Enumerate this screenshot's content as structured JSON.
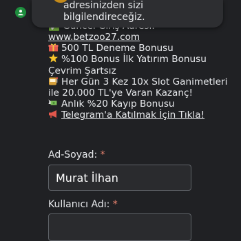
{
  "toast": {
    "line1": "adresinizden sizi",
    "line2": "bilgilendireceğiz."
  },
  "message": {
    "cut_line": "✅ Güncel Giriş Adresi:",
    "site_link": "www.betzoo27.com",
    "bonus1": "500 TL Deneme Bonusu",
    "bonus2": "%100 Bonus İlk Yatırım Bonusu",
    "bonus2b": "Çevrim Şartsız",
    "bonus3": "Her Gün 3 Kez 10x Slot Ganimetleri ile 20.000 TL'ye Varan Kazanç!",
    "bonus4": "Anlık %20 Kayıp Bonusu",
    "telegram_link": "Telegram'a Katılmak İçin Tıkla!"
  },
  "form": {
    "name_label": "Ad-Soyad:",
    "name_value": "Murat İlhan",
    "username_label": "Kullanıcı Adı:",
    "username_value": "",
    "required_mark": "*"
  },
  "icons": {
    "avatar": "person-icon",
    "gift": "gift-icon",
    "star": "star-icon",
    "slot": "slot-machine-icon",
    "money": "money-wings-icon",
    "megaphone": "megaphone-icon"
  },
  "colors": {
    "background": "#202124",
    "avatar": "#1e8e3e",
    "required": "#e8836f"
  }
}
